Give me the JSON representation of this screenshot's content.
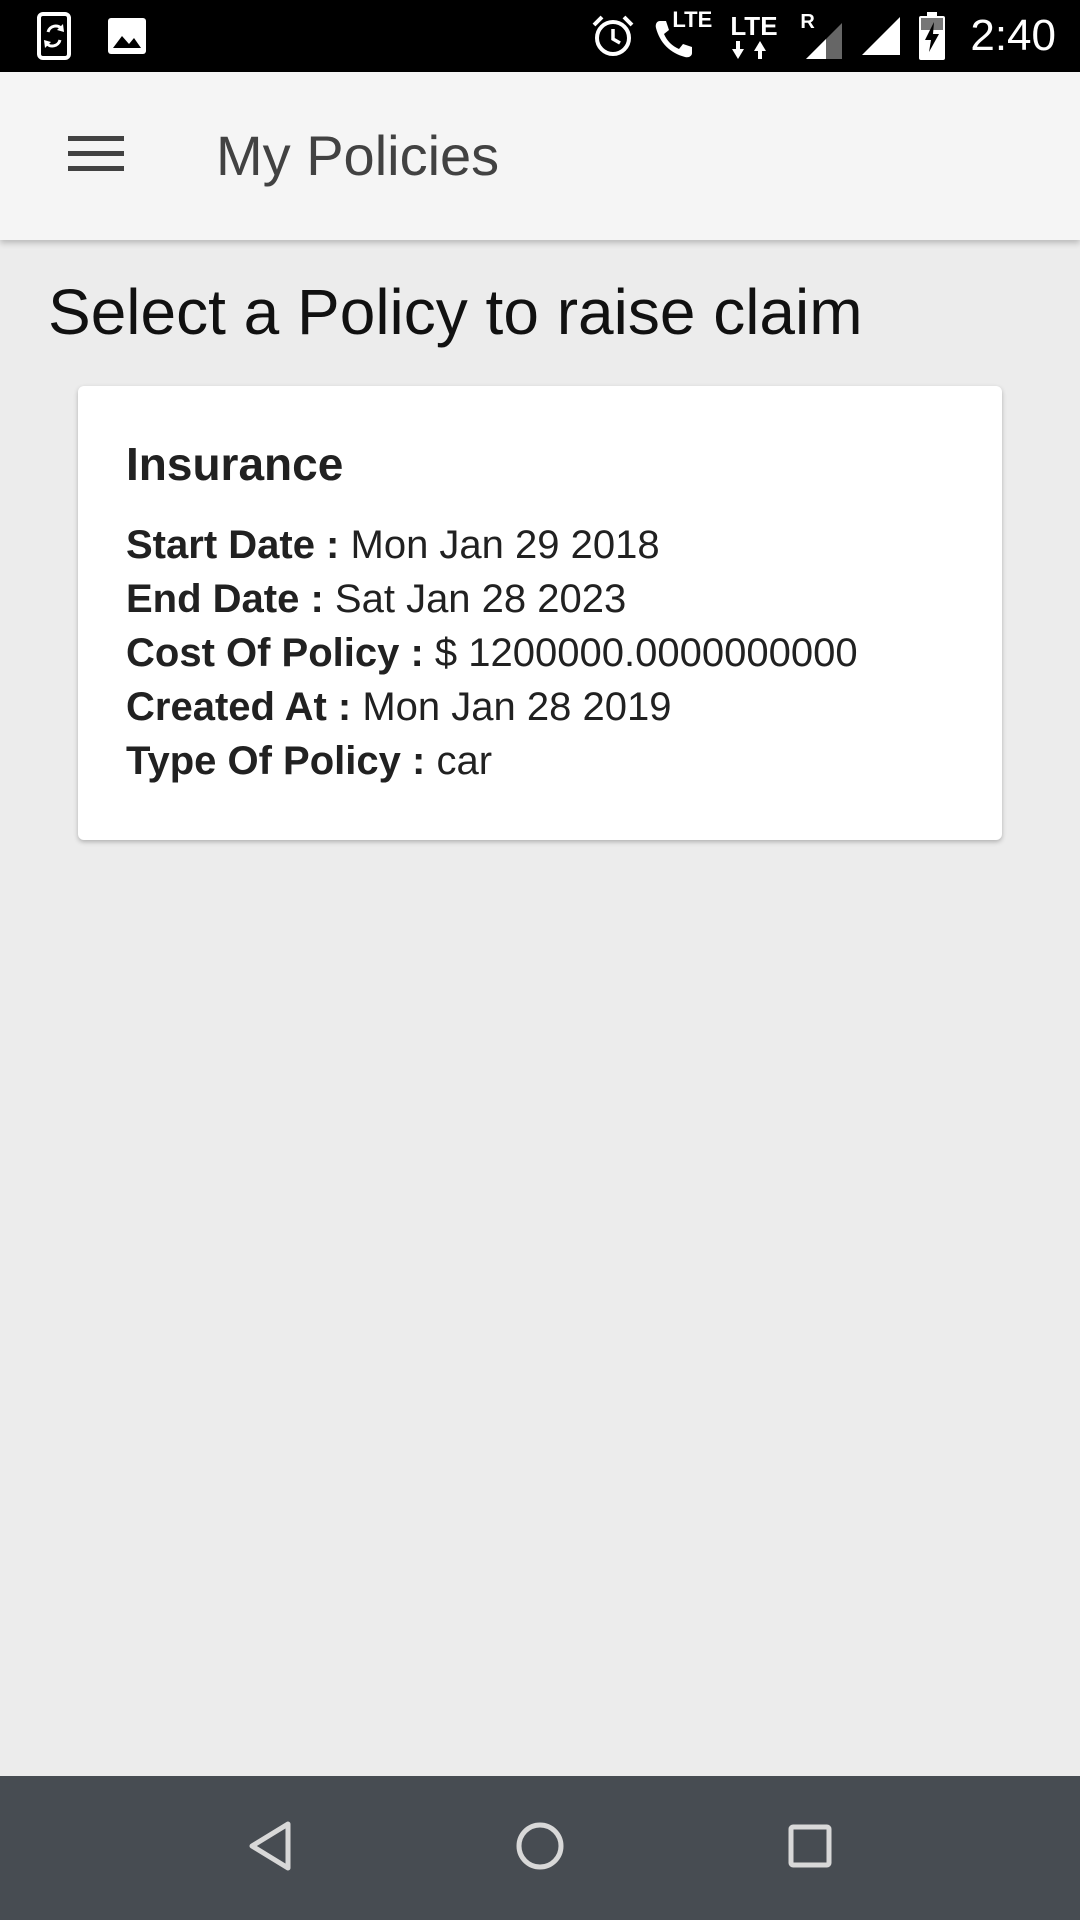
{
  "status_bar": {
    "time": "2:40",
    "lte_label_1": "LTE",
    "lte_label_2": "LTE",
    "roaming_label": "R",
    "left_icons": [
      "phone-sync-icon",
      "image-icon"
    ],
    "right_icons": [
      "alarm-icon",
      "volte-call-icon",
      "lte-data-icon",
      "signal-roaming-icon",
      "signal-full-icon",
      "battery-charging-icon"
    ]
  },
  "app_bar": {
    "menu_icon": "hamburger-menu-icon",
    "title": "My Policies"
  },
  "main": {
    "heading": "Select a Policy to raise claim",
    "policies": [
      {
        "title": "Insurance",
        "details": [
          {
            "label": "Start Date :",
            "value": " Mon Jan 29 2018"
          },
          {
            "label": "End Date :",
            "value": " Sat Jan 28 2023"
          },
          {
            "label": "Cost Of Policy :",
            "value": " $ 1200000.0000000000"
          },
          {
            "label": "Created At :",
            "value": " Mon Jan 28 2019"
          },
          {
            "label": "Type Of Policy :",
            "value": " car"
          }
        ]
      }
    ]
  },
  "nav_bar": {
    "buttons": [
      "back-icon",
      "home-icon",
      "recents-icon"
    ]
  },
  "colors": {
    "status_bar_bg": "#000000",
    "app_bar_bg": "#f5f5f5",
    "page_bg": "#ececec",
    "card_bg": "#ffffff",
    "nav_bar_bg": "#474c52"
  }
}
